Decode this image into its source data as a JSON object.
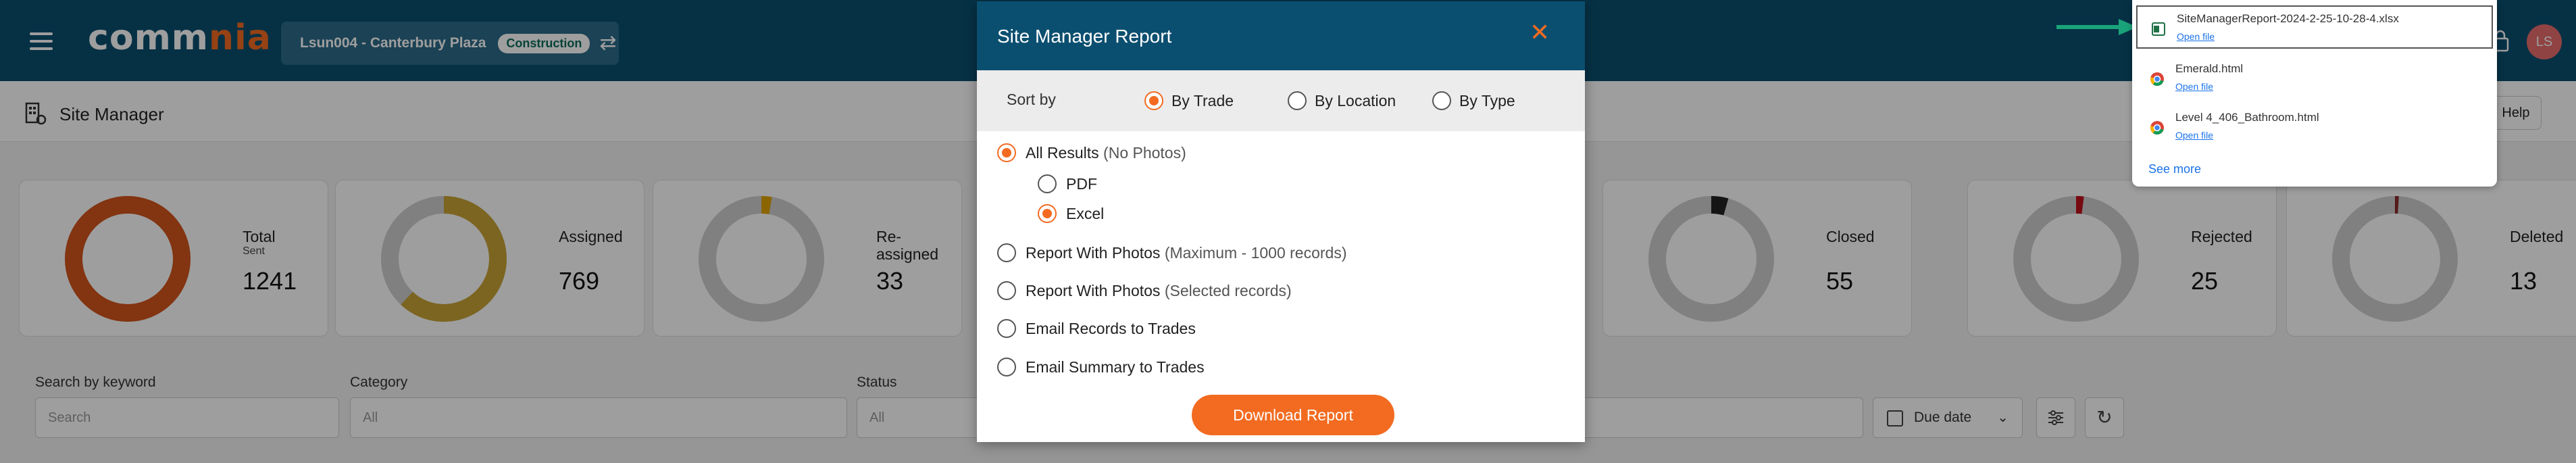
{
  "header": {
    "logo_prefix": "co",
    "logo_mid": "mm",
    "logo_suffix": "nia",
    "project_name": "Lsun004 - Canterbury Plaza",
    "project_badge": "Construction",
    "avatar_initials": "LS"
  },
  "subheader": {
    "title": "Site Manager",
    "help_label": "Help"
  },
  "cards": [
    {
      "label": "Total",
      "sub": "Sent",
      "value": "1241",
      "color": "#d4541c",
      "fill": 1.0
    },
    {
      "label": "Assigned",
      "sub": "",
      "value": "769",
      "color": "#c8a335",
      "fill": 0.62
    },
    {
      "label": "Re-\nassigned",
      "sub": "",
      "value": "33",
      "color": "#e0a400",
      "fill": 0.027
    },
    {
      "label": "Closed",
      "sub": "",
      "value": "55",
      "color": "#222222",
      "fill": 0.044
    },
    {
      "label": "Rejected",
      "sub": "",
      "value": "25",
      "color": "#c0101a",
      "fill": 0.02
    },
    {
      "label": "Deleted",
      "sub": "",
      "value": "13",
      "color": "#8a2a2a",
      "fill": 0.01
    }
  ],
  "filters": {
    "search_label": "Search by keyword",
    "search_placeholder": "Search",
    "category_label": "Category",
    "category_value": "All",
    "status_label": "Status",
    "status_value": "All",
    "due_label": "Due date"
  },
  "modal": {
    "title": "Site Manager Report",
    "sort_label": "Sort by",
    "sort_options": [
      "By Trade",
      "By Location",
      "By Type"
    ],
    "sort_selected": 0,
    "options": [
      {
        "main": "All Results",
        "muted": "(No Photos)"
      },
      {
        "main": "PDF",
        "muted": ""
      },
      {
        "main": "Excel",
        "muted": ""
      },
      {
        "main": "Report With Photos",
        "muted": "(Maximum - 1000 records)"
      },
      {
        "main": "Report With Photos",
        "muted": "(Selected records)"
      },
      {
        "main": "Email Records to Trades",
        "muted": ""
      },
      {
        "main": "Email Summary to Trades",
        "muted": ""
      }
    ],
    "download_label": "Download Report"
  },
  "downloads": {
    "items": [
      {
        "name": "SiteManagerReport-2024-2-25-10-28-4.xlsx",
        "link": "Open file",
        "icon": "excel-icon"
      },
      {
        "name": "Emerald.html",
        "link": "Open file",
        "icon": "chrome-icon"
      },
      {
        "name": "Level 4_406_Bathroom.html",
        "link": "Open file",
        "icon": "chrome-icon"
      }
    ],
    "see_more": "See more"
  },
  "colors": {
    "brand_blue": "#0b4f70",
    "accent_orange": "#f26b21",
    "arrow_green": "#1aa37a"
  }
}
